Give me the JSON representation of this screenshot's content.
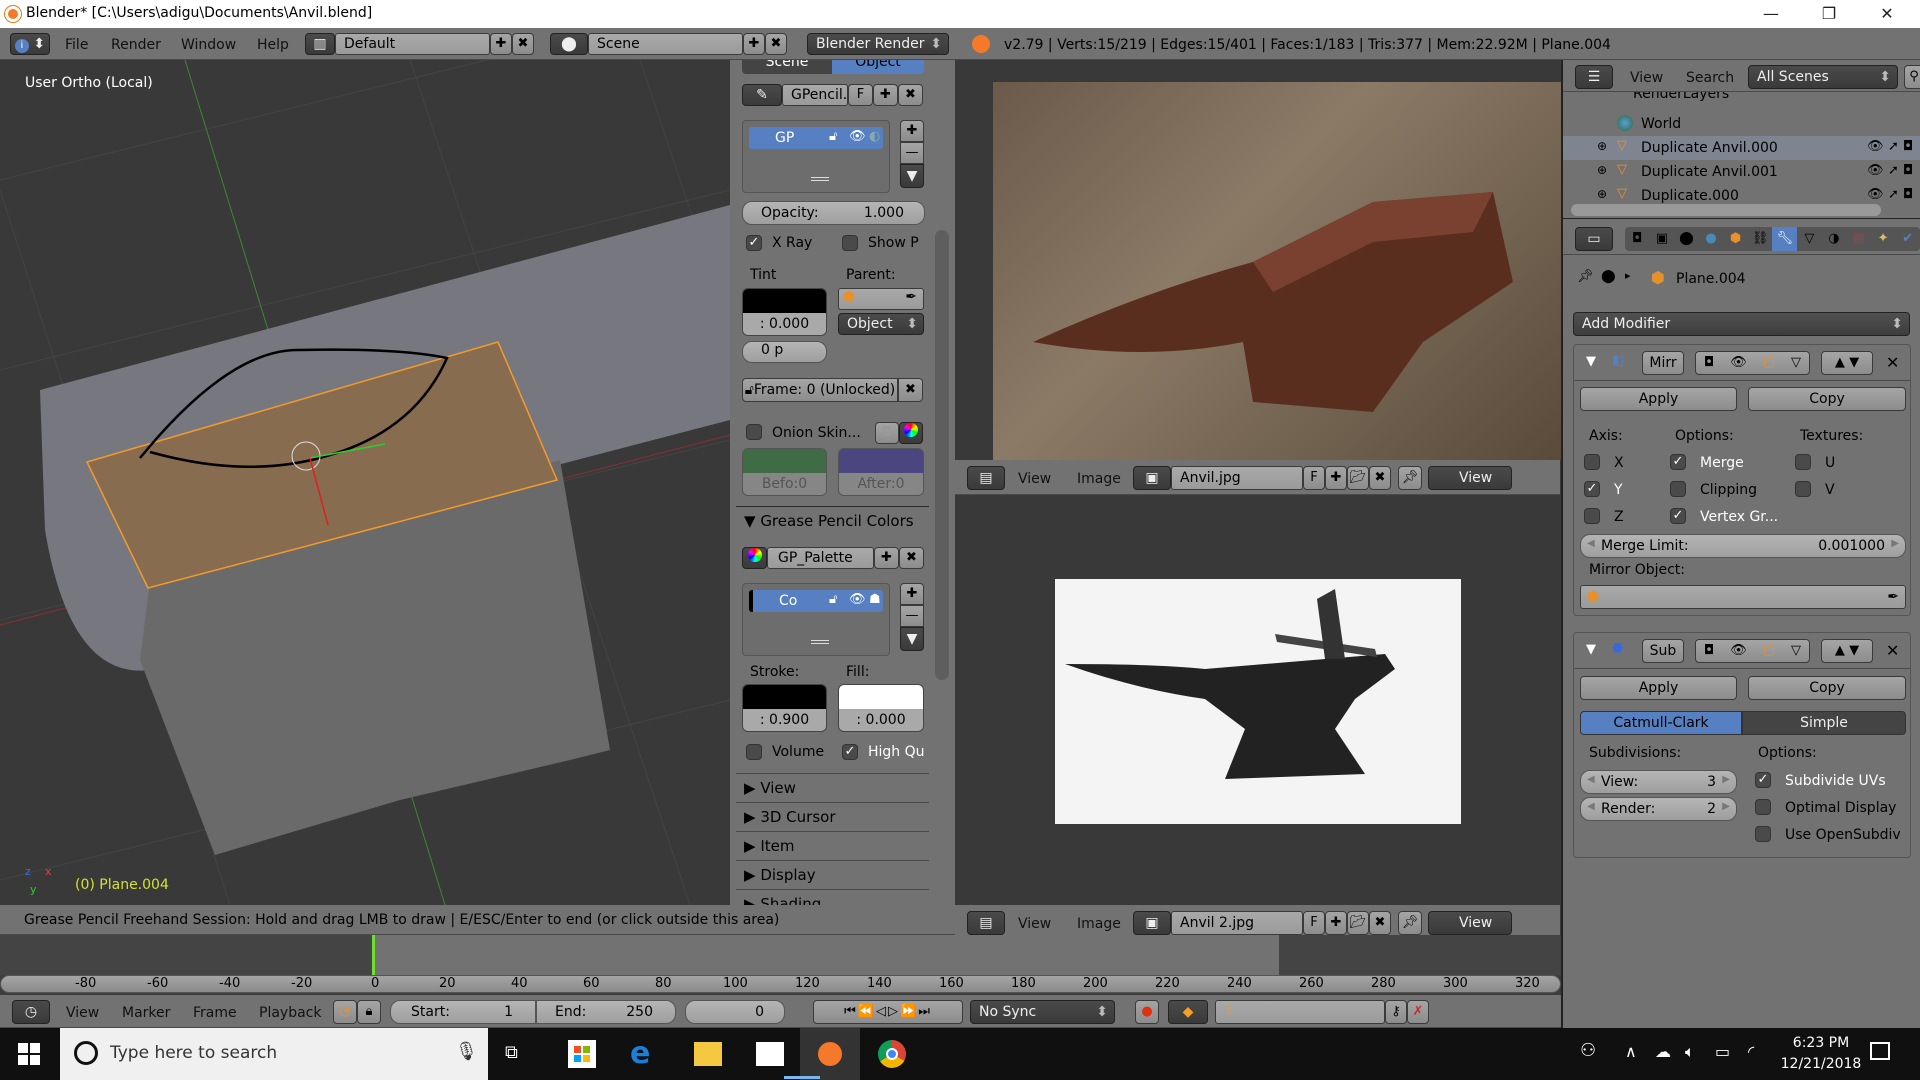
{
  "window": {
    "title": "Blender* [C:\\Users\\adigu\\Documents\\Anvil.blend]",
    "minimize": "—",
    "maximize": "❐",
    "close": "✕"
  },
  "info_header": {
    "menus": [
      "File",
      "Render",
      "Window",
      "Help"
    ],
    "layout": "Default",
    "scene": "Scene",
    "engine": "Blender Render",
    "stats": "v2.79 | Verts:15/219 | Edges:15/401 | Faces:1/183 | Tris:377 | Mem:22.92M | Plane.004"
  },
  "viewport": {
    "view_label": "User Ortho (Local)",
    "object_label": "(0) Plane.004",
    "axis_x": "x",
    "axis_y": "y",
    "axis_z": "z",
    "status": "Grease Pencil Freehand Session: Hold and drag LMB to draw | E/ESC/Enter to end  (or click outside this area)"
  },
  "gp_panel": {
    "tabs": [
      "Scene",
      "Object"
    ],
    "active_tab": "Object",
    "datablock": "GPencil.",
    "fake_user": "F",
    "layer": "GP",
    "opacity_label": "Opacity:",
    "opacity_value": "1.000",
    "xray_label": "X Ray",
    "xray_checked": true,
    "show_points_label": "Show P",
    "show_points_checked": false,
    "tint_label": "Tint",
    "tint_value": ": 0.000",
    "parent_label": "Parent:",
    "parent_type": "Object",
    "thickness": "0 p",
    "frame": "Frame: 0 (Unlocked)",
    "onion_label": "Onion Skin...",
    "onion_checked": false,
    "before": "Befo:0",
    "after": "After:0",
    "colors_header": "Grease Pencil Colors",
    "palette": "GP_Palette",
    "color_slot": "Co",
    "stroke_label": "Stroke:",
    "stroke_value": ": 0.900",
    "fill_label": "Fill:",
    "fill_value": ": 0.000",
    "volume_label": "Volume",
    "volume_checked": false,
    "hq_label": "High Qu",
    "hq_checked": true,
    "collapsed_panels": [
      "View",
      "3D Cursor",
      "Item",
      "Display",
      "Shading"
    ],
    "colors": {
      "onion_before": "#3f6b45",
      "onion_after": "#4b4580",
      "active": "#5680c2"
    }
  },
  "image_editor_top": {
    "menus": [
      "View",
      "Image"
    ],
    "image": "Anvil.jpg",
    "fake_user": "F",
    "view_mode": "View"
  },
  "image_editor_bottom": {
    "menus": [
      "View",
      "Image"
    ],
    "image": "Anvil 2.jpg",
    "fake_user": "F",
    "view_mode": "View"
  },
  "outliner": {
    "menus": [
      "View",
      "Search"
    ],
    "filter": "All Scenes",
    "items": [
      {
        "name": "RenderLayers",
        "type": "renderlayers"
      },
      {
        "name": "World",
        "type": "world"
      },
      {
        "name": "Duplicate Anvil.000",
        "type": "mesh"
      },
      {
        "name": "Duplicate Anvil.001",
        "type": "mesh"
      },
      {
        "name": "Duplicate.000",
        "type": "mesh"
      }
    ]
  },
  "properties": {
    "context_object": "Plane.004",
    "add_modifier": "Add Modifier",
    "mirror": {
      "name": "Mirr",
      "apply": "Apply",
      "copy": "Copy",
      "axis_label": "Axis:",
      "options_label": "Options:",
      "textures_label": "Textures:",
      "axis": [
        {
          "label": "X",
          "checked": false
        },
        {
          "label": "Y",
          "checked": true
        },
        {
          "label": "Z",
          "checked": false
        }
      ],
      "options": [
        {
          "label": "Merge",
          "checked": true
        },
        {
          "label": "Clipping",
          "checked": false
        },
        {
          "label": "Vertex Gr...",
          "checked": true
        }
      ],
      "textures": [
        {
          "label": "U",
          "checked": false
        },
        {
          "label": "V",
          "checked": false
        }
      ],
      "merge_limit_label": "Merge Limit:",
      "merge_limit_value": "0.001000",
      "mirror_object_label": "Mirror Object:"
    },
    "subsurf": {
      "name": "Sub",
      "apply": "Apply",
      "copy": "Copy",
      "mode_active": "Catmull-Clark",
      "mode_other": "Simple",
      "subdivisions_label": "Subdivisions:",
      "options_label": "Options:",
      "view_label": "View:",
      "view_value": "3",
      "render_label": "Render:",
      "render_value": "2",
      "options": [
        {
          "label": "Subdivide UVs",
          "checked": true
        },
        {
          "label": "Optimal Display",
          "checked": false
        },
        {
          "label": "Use OpenSubdiv",
          "checked": false
        }
      ]
    }
  },
  "timeline": {
    "ruler": [
      "-80",
      "-60",
      "-40",
      "-20",
      "0",
      "20",
      "40",
      "60",
      "80",
      "100",
      "120",
      "140",
      "160",
      "180",
      "200",
      "220",
      "240",
      "260",
      "280",
      "300",
      "320"
    ],
    "current_frame": "0",
    "menus": [
      "View",
      "Marker",
      "Frame",
      "Playback"
    ],
    "start_label": "Start:",
    "start_value": "1",
    "end_label": "End:",
    "end_value": "250",
    "sync": "No Sync"
  },
  "taskbar": {
    "search_placeholder": "Type here to search",
    "time": "6:23 PM",
    "date": "12/21/2018"
  }
}
